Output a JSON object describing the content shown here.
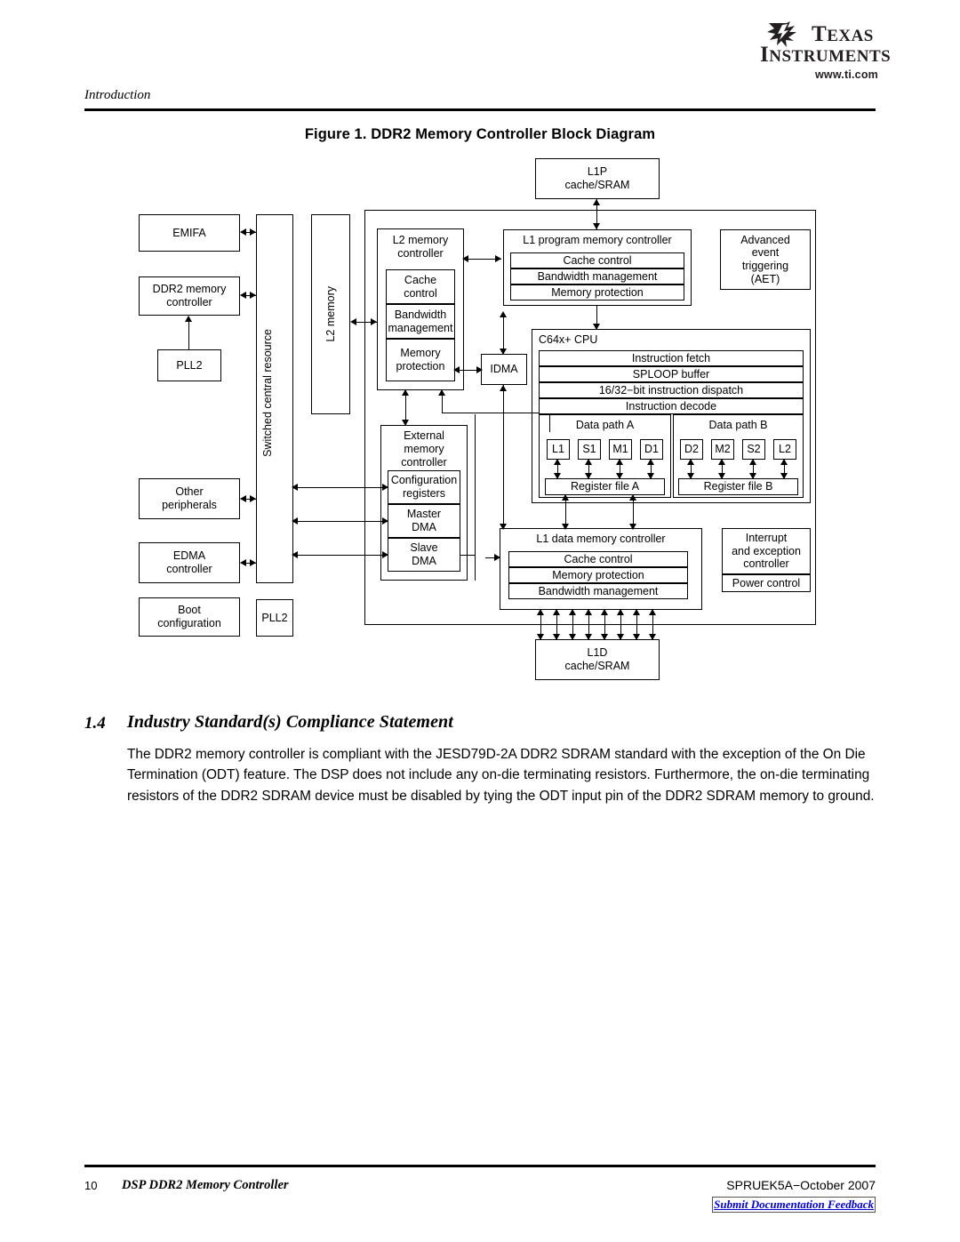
{
  "logo": {
    "line1": "TEXAS",
    "line2": "INSTRUMENTS",
    "url": "www.ti.com",
    "mark": "ti-star-mark"
  },
  "header": {
    "section": "Introduction"
  },
  "figure": {
    "title": "Figure 1. DDR2 Memory Controller Block Diagram"
  },
  "diagram": {
    "left_blocks": [
      {
        "id": "emifa",
        "text": "EMIFA"
      },
      {
        "id": "ddr2",
        "text": "DDR2 memory\ncontroller"
      },
      {
        "id": "pll2a",
        "text": "PLL2"
      },
      {
        "id": "other",
        "text": "Other\nperipherals"
      },
      {
        "id": "edma",
        "text": "EDMA\ncontroller"
      },
      {
        "id": "boot",
        "text": "Boot\nconfiguration"
      },
      {
        "id": "pll2b",
        "text": "PLL2"
      }
    ],
    "scr_label": "Switched central resource",
    "l2mem_label": "L2 memory",
    "l2ctrl": {
      "title": "L2 memory\ncontroller",
      "rows": [
        "Cache\ncontrol",
        "Bandwidth\nmanagement",
        "Memory\nprotection"
      ]
    },
    "extmem": {
      "title": "External\nmemory\ncontroller",
      "rows": [
        "Configuration\nregisters",
        "Master\nDMA",
        "Slave\nDMA"
      ]
    },
    "idma": "IDMA",
    "l1p_cache": "L1P\ncache/SRAM",
    "l1d_cache": "L1D\ncache/SRAM",
    "l1p_ctrl": {
      "title": "L1 program memory controller",
      "rows": [
        "Cache control",
        "Bandwidth management",
        "Memory protection"
      ]
    },
    "l1d_ctrl": {
      "title": "L1 data memory controller",
      "rows": [
        "Cache control",
        "Memory protection",
        "Bandwidth management"
      ]
    },
    "aet": "Advanced\nevent\ntriggering\n(AET)",
    "interrupt": "Interrupt\nand exception\ncontroller",
    "power": "Power control",
    "cpu": {
      "title": "C64x+ CPU",
      "pipeline": [
        "Instruction fetch",
        "SPLOOP buffer",
        "16/32−bit instruction dispatch",
        "Instruction decode"
      ],
      "path_a_label": "Data path A",
      "path_b_label": "Data path B",
      "units_a": [
        "L1",
        "S1",
        "M1",
        "D1"
      ],
      "units_b": [
        "D2",
        "M2",
        "S2",
        "L2"
      ],
      "regfile_a": "Register file A",
      "regfile_b": "Register file B"
    }
  },
  "section": {
    "number": "1.4",
    "title": "Industry Standard(s) Compliance Statement",
    "paragraph": "The DDR2 memory controller is compliant with the JESD79D-2A DDR2 SDRAM standard with the exception of the On Die Termination (ODT) feature. The DSP does not include any on-die terminating resistors. Furthermore, the on-die terminating resistors of the DDR2 SDRAM device must be disabled by tying the ODT input pin of the DDR2 SDRAM memory to ground."
  },
  "footer": {
    "page": "10",
    "doc_title": "DSP DDR2 Memory Controller",
    "literature": "SPRUEK5A−October 2007",
    "feedback": "Submit Documentation Feedback"
  }
}
